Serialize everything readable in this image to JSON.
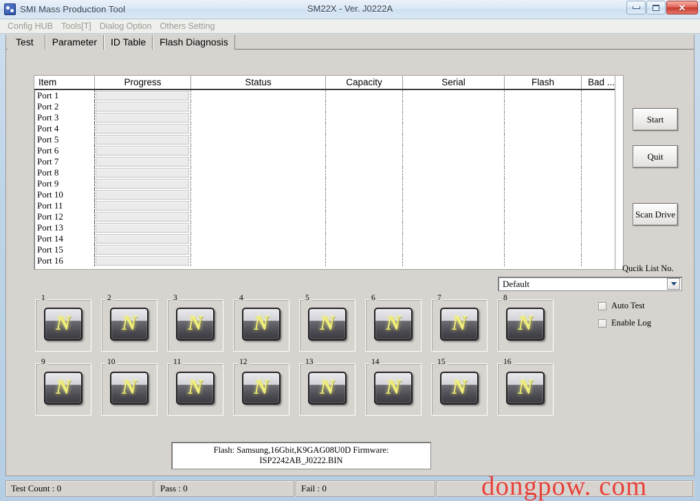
{
  "window": {
    "title": "SMI Mass Production Tool",
    "center_title": "SM22X - Ver. J0222A",
    "app_icon": "app-icon",
    "controls": {
      "minimize": "minimize-icon",
      "maximize": "maximize-icon",
      "close": "close-icon",
      "close_glyph": "✕"
    }
  },
  "menu": {
    "items": [
      {
        "label": "Config HUB"
      },
      {
        "label": "Tools[T]"
      },
      {
        "label": "Dialog Option"
      },
      {
        "label": "Others Setting"
      }
    ]
  },
  "tabs": [
    {
      "label": "Test",
      "active": true
    },
    {
      "label": "Parameter",
      "active": false
    },
    {
      "label": "ID Table",
      "active": false
    },
    {
      "label": "Flash Diagnosis",
      "active": false
    }
  ],
  "grid": {
    "columns": [
      {
        "label": "Item",
        "width": 88
      },
      {
        "label": "Progress",
        "width": 140
      },
      {
        "label": "Status",
        "width": 196
      },
      {
        "label": "Capacity",
        "width": 112
      },
      {
        "label": "Serial",
        "width": 148
      },
      {
        "label": "Flash",
        "width": 112
      },
      {
        "label": "Bad ...",
        "width": 58
      }
    ],
    "rows": [
      {
        "item": "Port 1",
        "progress": "",
        "status": "",
        "capacity": "",
        "serial": "",
        "flash": "",
        "bad": ""
      },
      {
        "item": "Port 2",
        "progress": "",
        "status": "",
        "capacity": "",
        "serial": "",
        "flash": "",
        "bad": ""
      },
      {
        "item": "Port 3",
        "progress": "",
        "status": "",
        "capacity": "",
        "serial": "",
        "flash": "",
        "bad": ""
      },
      {
        "item": "Port 4",
        "progress": "",
        "status": "",
        "capacity": "",
        "serial": "",
        "flash": "",
        "bad": ""
      },
      {
        "item": "Port 5",
        "progress": "",
        "status": "",
        "capacity": "",
        "serial": "",
        "flash": "",
        "bad": ""
      },
      {
        "item": "Port 6",
        "progress": "",
        "status": "",
        "capacity": "",
        "serial": "",
        "flash": "",
        "bad": ""
      },
      {
        "item": "Port 7",
        "progress": "",
        "status": "",
        "capacity": "",
        "serial": "",
        "flash": "",
        "bad": ""
      },
      {
        "item": "Port 8",
        "progress": "",
        "status": "",
        "capacity": "",
        "serial": "",
        "flash": "",
        "bad": ""
      },
      {
        "item": "Port 9",
        "progress": "",
        "status": "",
        "capacity": "",
        "serial": "",
        "flash": "",
        "bad": ""
      },
      {
        "item": "Port 10",
        "progress": "",
        "status": "",
        "capacity": "",
        "serial": "",
        "flash": "",
        "bad": ""
      },
      {
        "item": "Port 11",
        "progress": "",
        "status": "",
        "capacity": "",
        "serial": "",
        "flash": "",
        "bad": ""
      },
      {
        "item": "Port 12",
        "progress": "",
        "status": "",
        "capacity": "",
        "serial": "",
        "flash": "",
        "bad": ""
      },
      {
        "item": "Port 13",
        "progress": "",
        "status": "",
        "capacity": "",
        "serial": "",
        "flash": "",
        "bad": ""
      },
      {
        "item": "Port 14",
        "progress": "",
        "status": "",
        "capacity": "",
        "serial": "",
        "flash": "",
        "bad": ""
      },
      {
        "item": "Port 15",
        "progress": "",
        "status": "",
        "capacity": "",
        "serial": "",
        "flash": "",
        "bad": ""
      },
      {
        "item": "Port 16",
        "progress": "",
        "status": "",
        "capacity": "",
        "serial": "",
        "flash": "",
        "bad": ""
      }
    ]
  },
  "buttons": {
    "start": "Start",
    "quit": "Quit",
    "scan_drive": "Scan Drive"
  },
  "quick_list": {
    "label": "Qucik List No.",
    "selected": "Default",
    "options": [
      "Default"
    ]
  },
  "checkboxes": [
    {
      "label": "Auto Test",
      "checked": false
    },
    {
      "label": "Enable Log",
      "checked": false
    }
  ],
  "slots": {
    "icon_letter": "N",
    "row1": [
      {
        "num": "1"
      },
      {
        "num": "2"
      },
      {
        "num": "3"
      },
      {
        "num": "4"
      },
      {
        "num": "5"
      },
      {
        "num": "6"
      },
      {
        "num": "7"
      },
      {
        "num": "8"
      }
    ],
    "row2": [
      {
        "num": "9"
      },
      {
        "num": "10"
      },
      {
        "num": "11"
      },
      {
        "num": "12"
      },
      {
        "num": "13"
      },
      {
        "num": "14"
      },
      {
        "num": "15"
      },
      {
        "num": "16"
      }
    ]
  },
  "flash_info": {
    "line1": "Flash:  Samsung,16Gbit,K9GAG08U0D     Firmware:",
    "line2": "ISP2242AB_J0222.BIN"
  },
  "statusbar": {
    "panels": [
      {
        "label": "Test Count : 0"
      },
      {
        "label": "Pass : 0"
      },
      {
        "label": "Fail : 0"
      },
      {
        "label": ""
      }
    ]
  },
  "watermark": {
    "text": "dongpow. com",
    "color": "#e8352c"
  },
  "colors": {
    "window_bg": "#d7d4d0",
    "aero_frame": "#bdd4e8",
    "grid_bg": "#ffffff",
    "led_yellow": "#f2f07a",
    "close_red": "#c23b2e"
  }
}
